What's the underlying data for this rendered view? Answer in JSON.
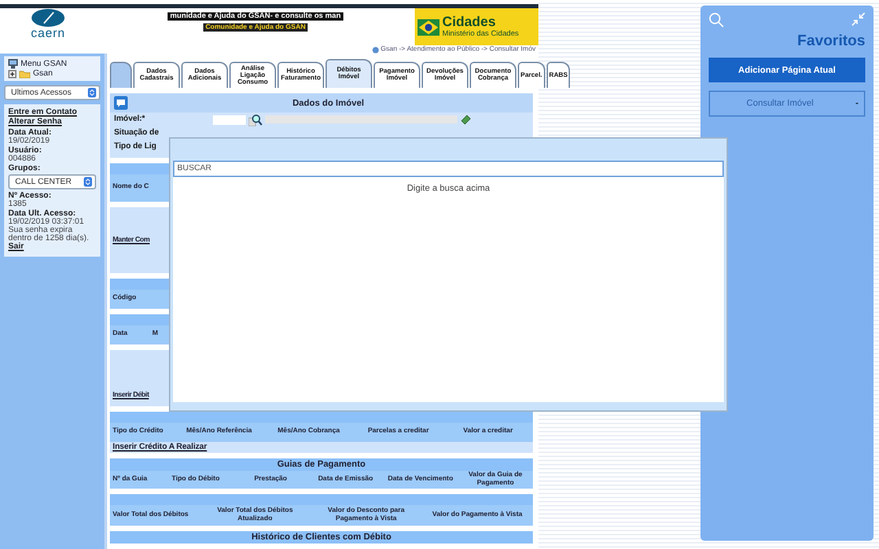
{
  "header": {
    "logo": "caern",
    "marquee": "munidade e Ajuda do GSAN- e consulte os man",
    "community_link": "Comunidade e Ajuda do GSAN",
    "ministry": {
      "title": "Cidades",
      "subtitle": "Ministério das Cidades"
    },
    "breadcrumb": "Gsan -> Atendimento ao Público -> Consultar Imóv"
  },
  "sidebar": {
    "menu_title": "Menu GSAN",
    "tree": [
      {
        "label": "Gsan",
        "expanded": false
      }
    ],
    "recent_select": "Ultimos Acessos",
    "links": [
      "Entre em Contato",
      "Alterar Senha"
    ],
    "info": [
      {
        "kind": "text",
        "label": "Data Atual:",
        "value": "19/02/2019"
      },
      {
        "kind": "text",
        "label": "Usuário:",
        "value": "004886"
      },
      {
        "kind": "select",
        "label": "Grupos:",
        "value": "CALL CENTER"
      },
      {
        "kind": "text",
        "label": "Nº Acesso:",
        "value": "1385"
      },
      {
        "kind": "text",
        "label": "Data Ult. Acesso:",
        "value": "19/02/2019 03:37:01"
      }
    ],
    "notice": "Sua senha expira dentro de 1258 dia(s).",
    "logout": "Sair"
  },
  "tabs": [
    {
      "label": "Dados Cadastrais",
      "selected": false
    },
    {
      "label": "Dados Adicionais",
      "selected": false
    },
    {
      "label": "Análise Ligação Consumo",
      "selected": false
    },
    {
      "label": "Histórico Faturamento",
      "selected": false
    },
    {
      "label": "Débitos Imóvel",
      "selected": true
    },
    {
      "label": "Pagamento Imóvel",
      "selected": false
    },
    {
      "label": "Devoluções Imóvel",
      "selected": false
    },
    {
      "label": "Documento Cobrança",
      "selected": false
    },
    {
      "label": "Parcel.",
      "selected": false
    },
    {
      "label": "RABS",
      "selected": false
    }
  ],
  "property": {
    "title": "Dados do Imóvel",
    "fields": [
      "Imóvel:*",
      "Situação de",
      "Tipo de Lig"
    ]
  },
  "blocks": [
    {
      "kind": "table",
      "columns": [
        "Nome do C"
      ]
    },
    {
      "kind": "link",
      "text": "Manter Com"
    },
    {
      "kind": "table",
      "columns": [
        "Código"
      ]
    },
    {
      "kind": "table",
      "columns": [
        "Data",
        "M"
      ]
    },
    {
      "kind": "link",
      "text": "Inserir Débit"
    },
    {
      "kind": "table",
      "columns": [
        "Tipo do Crédito",
        "Mês/Ano Referência",
        "Mês/Ano Cobrança",
        "Parcelas a creditar",
        "Valor a creditar"
      ],
      "link": "Inserir Crédito A Realizar"
    },
    {
      "kind": "table",
      "title": "Guias de Pagamento",
      "columns": [
        "Nº da Guia",
        "Tipo do Débito",
        "Prestação",
        "Data de Emissão",
        "Data de Vencimento",
        "Valor da Guia de Pagamento"
      ]
    },
    {
      "kind": "table",
      "columns": [
        "Valor Total dos Débitos",
        "Valor Total dos Débitos Atualizado",
        "Valor do Desconto para Pagamento à Vista",
        "Valor do Pagamento à Vista"
      ]
    },
    {
      "kind": "table",
      "title": "Histórico de Clientes com Débito"
    }
  ],
  "favorites": {
    "title": "Favoritos",
    "add_button": "Adicionar Página Atual",
    "select": {
      "value": "Consultar Imóvel",
      "toggle": "-"
    }
  },
  "search_modal": {
    "search": {
      "placeholder": "BUSCAR"
    },
    "message": "Digite a busca acima"
  }
}
